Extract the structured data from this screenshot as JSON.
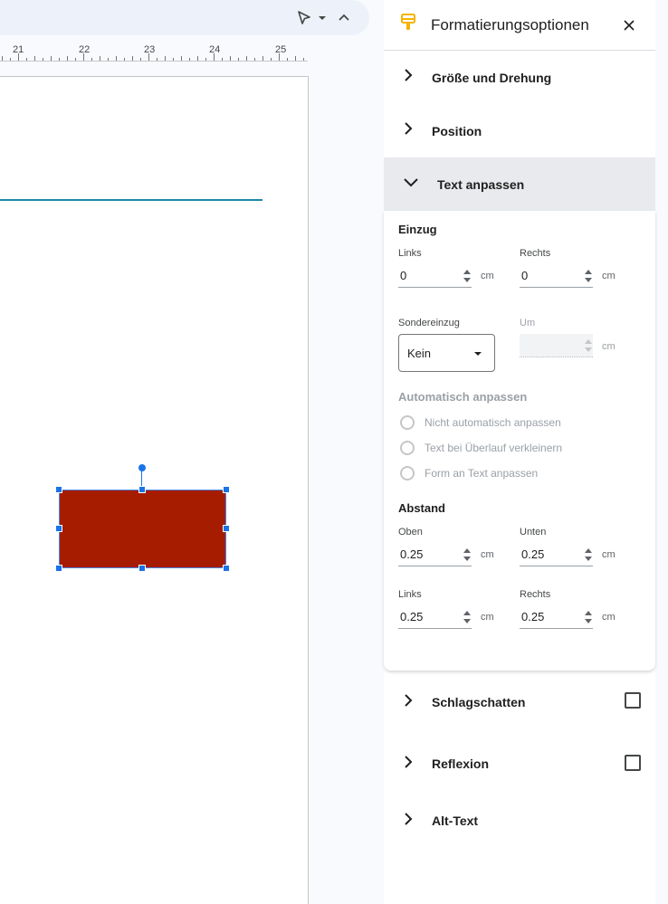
{
  "panel": {
    "title": "Formatierungsoptionen",
    "sections": {
      "size_rotation": "Größe und Drehung",
      "position": "Position",
      "text_fit": "Text anpassen",
      "drop_shadow": "Schlagschatten",
      "reflection": "Reflexion",
      "alt_text": "Alt-Text"
    }
  },
  "ruler": {
    "numbers": [
      "21",
      "22",
      "23",
      "24",
      "25"
    ]
  },
  "text_fit": {
    "indent_heading": "Einzug",
    "left_label": "Links",
    "right_label": "Rechts",
    "indent_left": "0",
    "indent_right": "0",
    "unit": "cm",
    "special_indent_label": "Sondereinzug",
    "special_indent_value": "Kein",
    "by_label": "Um",
    "autofit_heading": "Automatisch anpassen",
    "autofit_options": [
      "Nicht automatisch anpassen",
      "Text bei Überlauf verkleinern",
      "Form an Text anpassen"
    ],
    "spacing_heading": "Abstand",
    "top_label": "Oben",
    "bottom_label": "Unten",
    "pad_top": "0.25",
    "pad_bottom": "0.25",
    "pad_left": "0.25",
    "pad_right": "0.25"
  },
  "colors": {
    "shape_fill": "#a61c00",
    "selection": "#1a73e8",
    "accent_icon": "#f4b400"
  }
}
